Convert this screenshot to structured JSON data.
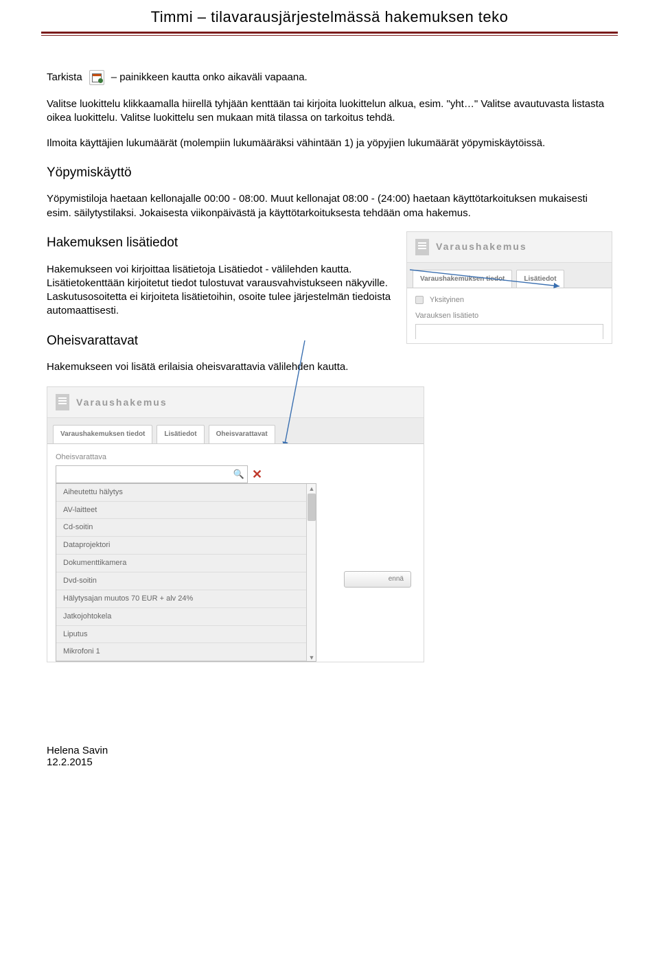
{
  "header": {
    "title": "Timmi – tilavarausjärjestelmässä hakemuksen teko"
  },
  "intro": {
    "tarkista": "Tarkista",
    "after_icon": "– painikkeen kautta onko aikaväli vapaana.",
    "p1": "Valitse luokittelu klikkaamalla hiirellä tyhjään kenttään tai kirjoita luokittelun alkua, esim. \"yht…\" Valitse avautuvasta listasta oikea luokittelu. Valitse luokittelu sen mukaan mitä tilassa on tarkoitus tehdä.",
    "p2": "Ilmoita käyttäjien lukumäärät (molempiin lukumääräksi vähintään 1) ja yöpyjien lukumäärät yöpymiskäytöissä."
  },
  "yopy": {
    "h": "Yöpymiskäyttö",
    "p": "Yöpymistiloja haetaan kellonajalle 00:00 - 08:00. Muut kellonajat 08:00 - (24:00) haetaan käyttötarkoituksen mukaisesti esim. säilytystilaksi. Jokaisesta viikonpäivästä ja käyttötarkoituksesta tehdään oma hakemus."
  },
  "lisatiedot": {
    "h": "Hakemuksen lisätiedot",
    "p": "Hakemukseen voi kirjoittaa lisätietoja Lisätiedot - välilehden kautta. Lisätietokenttään kirjoitetut tiedot tulostuvat varausvahvistukseen näkyville. Laskutusosoitetta ei kirjoiteta lisätietoihin, osoite tulee järjestelmän tiedoista automaattisesti."
  },
  "oheis": {
    "h": "Oheisvarattavat",
    "p": "Hakemukseen voi lisätä erilaisia oheisvarattavia välilehden kautta."
  },
  "panel_right": {
    "title": "Varaushakemus",
    "tabs": [
      "Varaushakemuksen tiedot",
      "Lisätiedot"
    ],
    "checkbox_label": "Yksityinen",
    "field_label": "Varauksen lisätieto"
  },
  "panel_bottom": {
    "title": "Varaushakemus",
    "tabs": [
      "Varaushakemuksen tiedot",
      "Lisätiedot",
      "Oheisvarattavat"
    ],
    "field_label": "Oheisvarattava",
    "options": [
      "Aiheutettu hälytys",
      "AV-laitteet",
      "Cd-soitin",
      "Dataprojektori",
      "Dokumenttikamera",
      "Dvd-soitin",
      "Hälytysajan muutos 70 EUR + alv 24%",
      "Jatkojohtokela",
      "Liputus",
      "Mikrofoni 1"
    ],
    "button_suffix": "ennä"
  },
  "footer": {
    "author": "Helena Savin",
    "date": "12.2.2015"
  }
}
